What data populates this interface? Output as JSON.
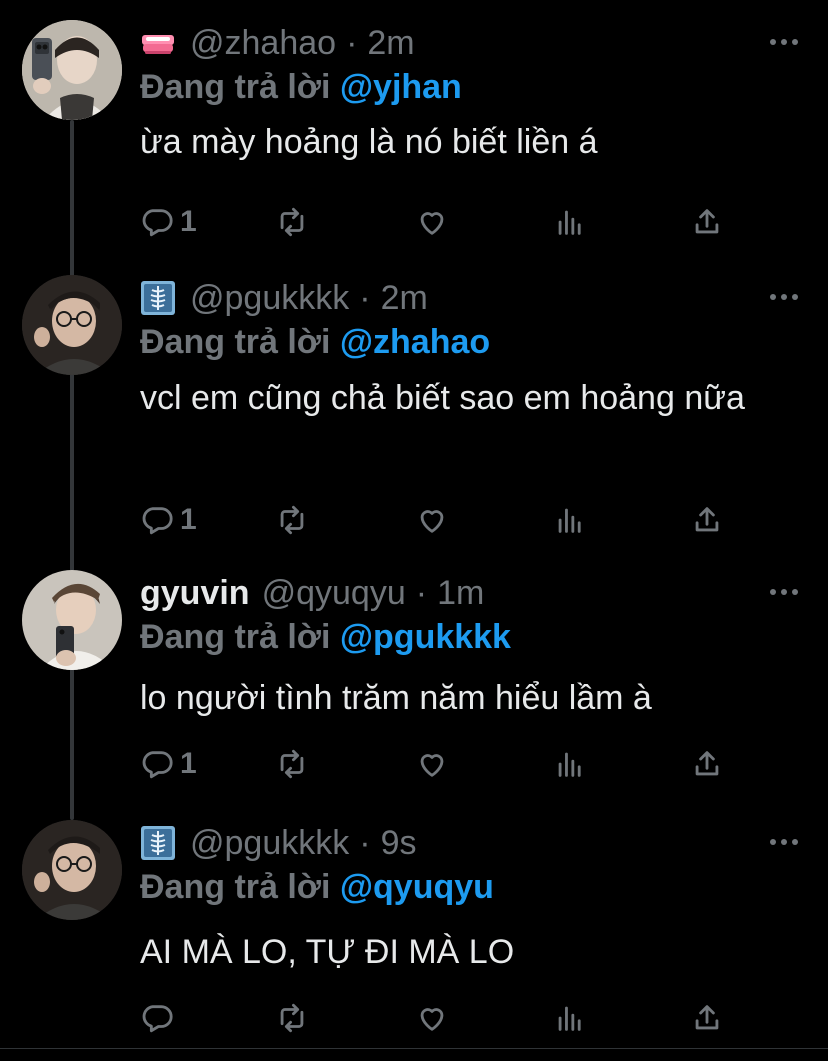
{
  "thread": [
    {
      "avatar": "avatar-boy-selfie-mirror",
      "badge": "jewelry-box-emoji",
      "display_name": "",
      "handle": "@zhahao",
      "dot": "·",
      "time": "2m",
      "reply_prefix": "Đang trả lời ",
      "reply_mention": "@yjhan",
      "text": "ừa mày hoảng là nó biết liền á",
      "reply_count": "1"
    },
    {
      "avatar": "avatar-boy-glasses",
      "badge": "xray-emoji",
      "display_name": "",
      "handle": "@pgukkkk",
      "dot": "·",
      "time": "2m",
      "reply_prefix": "Đang trả lời ",
      "reply_mention": "@zhahao",
      "text": "vcl em cũng chả biết sao em hoảng nữa",
      "reply_count": "1"
    },
    {
      "avatar": "avatar-boy-phone",
      "badge": "",
      "display_name": "gyuvin",
      "handle": "@qyuqyu",
      "dot": "·",
      "time": "1m",
      "reply_prefix": "Đang trả lời ",
      "reply_mention": "@pgukkkk",
      "text": "lo người tình trăm năm hiểu lầm à",
      "reply_count": "1"
    },
    {
      "avatar": "avatar-boy-glasses",
      "badge": "xray-emoji",
      "display_name": "",
      "handle": "@pgukkkk",
      "dot": "·",
      "time": "9s",
      "reply_prefix": "Đang trả lời ",
      "reply_mention": "@qyuqyu",
      "text": "AI MÀ LO, TỰ ĐI MÀ LO",
      "reply_count": ""
    }
  ],
  "colors": {
    "background": "#000000",
    "text": "#e7e9ea",
    "muted": "#71767b",
    "mention": "#1d9bf0",
    "thread_line": "#333639"
  },
  "icons": [
    "reply-icon",
    "retweet-icon",
    "like-icon",
    "views-icon",
    "share-icon",
    "more-icon"
  ]
}
